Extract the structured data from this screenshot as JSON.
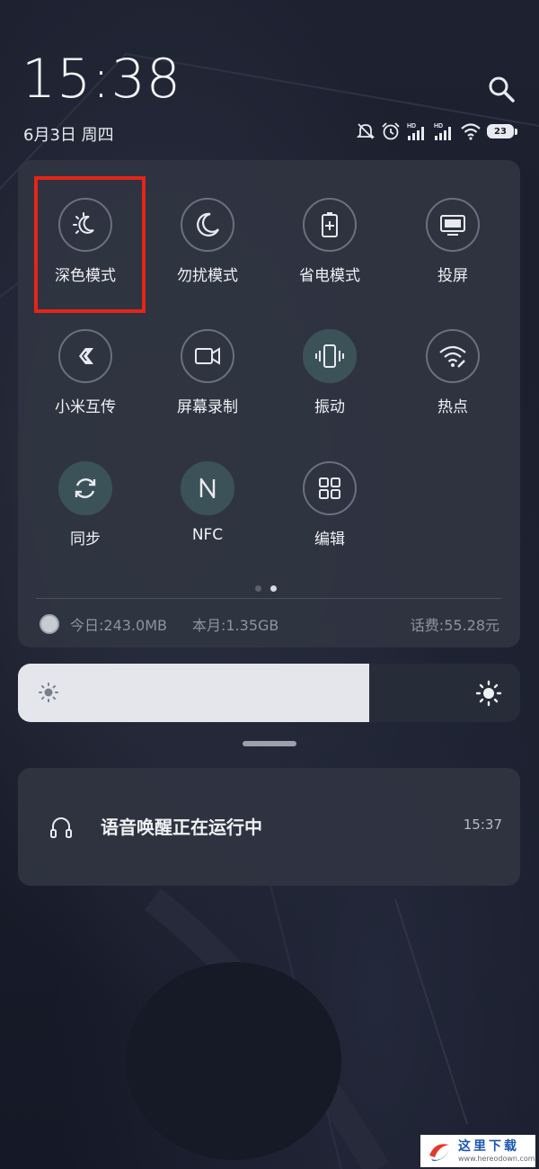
{
  "status": {
    "time": "15:38",
    "date": "6月3日 周四",
    "battery_level": "23",
    "icons": [
      "silent-icon",
      "alarm-icon",
      "hd-signal-icon",
      "hd-signal-icon",
      "wifi-icon",
      "battery-icon"
    ]
  },
  "quick_settings": {
    "tiles": [
      {
        "label": "深色模式",
        "icon": "dark-mode-icon",
        "active": false
      },
      {
        "label": "勿扰模式",
        "icon": "moon-icon",
        "active": false
      },
      {
        "label": "省电模式",
        "icon": "battery-saver-icon",
        "active": false
      },
      {
        "label": "投屏",
        "icon": "screencast-icon",
        "active": false
      },
      {
        "label": "小米互传",
        "icon": "mi-share-icon",
        "active": false
      },
      {
        "label": "屏幕录制",
        "icon": "screen-record-icon",
        "active": false
      },
      {
        "label": "振动",
        "icon": "vibrate-icon",
        "active": true
      },
      {
        "label": "热点",
        "icon": "hotspot-icon",
        "active": false
      },
      {
        "label": "同步",
        "icon": "sync-icon",
        "active": true
      },
      {
        "label": "NFC",
        "icon": "nfc-icon",
        "active": true
      },
      {
        "label": "编辑",
        "icon": "edit-grid-icon",
        "active": false
      }
    ],
    "page_count": 2,
    "current_page": 2,
    "data_usage": {
      "today": "今日:243.0MB",
      "month": "本月:1.35GB",
      "fee": "话费:55.28元"
    }
  },
  "brightness": {
    "level_fraction": 0.7
  },
  "notification": {
    "title": "语音唤醒正在运行中",
    "time": "15:37",
    "icon": "headset-icon"
  },
  "watermark": {
    "text": "这里下载",
    "url": "www.hereodown.com"
  },
  "colors": {
    "highlight": "#e42518",
    "active_tile": "#3b5358",
    "panel": "#303542"
  }
}
